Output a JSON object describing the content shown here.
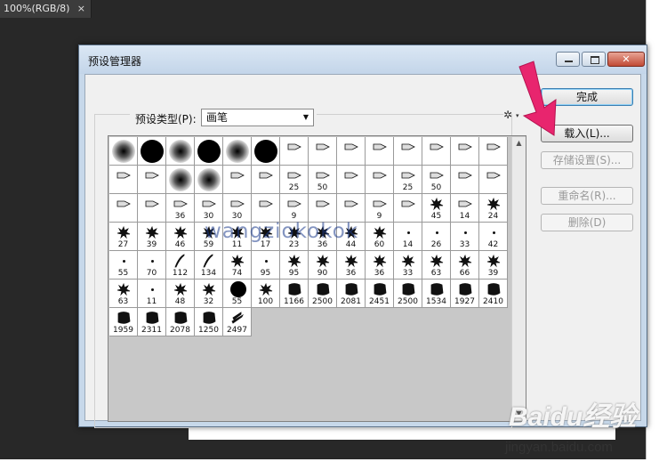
{
  "app": {
    "doc_tab_title": "100%(RGB/8)",
    "doc_tab_close": "×"
  },
  "dialog": {
    "title": "预设管理器",
    "preset_type_label": "预设类型(P):",
    "preset_type_value": "画笔",
    "gear_icon": "gear-icon",
    "buttons": {
      "done": "完成",
      "load": "载入(L)...",
      "save_set": "存储设置(S)...",
      "rename": "重命名(R)...",
      "delete": "删除(D)"
    },
    "brush_rows": [
      [
        {
          "k": "soft"
        },
        {
          "k": "hard"
        },
        {
          "k": "soft"
        },
        {
          "k": "hard"
        },
        {
          "k": "soft"
        },
        {
          "k": "hard"
        },
        {
          "k": "tip",
          "n": ""
        },
        {
          "k": "tip",
          "n": ""
        },
        {
          "k": "tip",
          "n": ""
        },
        {
          "k": "tip",
          "n": ""
        },
        {
          "k": "tip",
          "n": ""
        },
        {
          "k": "tip",
          "n": ""
        },
        {
          "k": "tip",
          "n": ""
        },
        {
          "k": "tip",
          "n": ""
        }
      ],
      [
        {
          "k": "tip",
          "n": ""
        },
        {
          "k": "tip",
          "n": ""
        },
        {
          "k": "soft"
        },
        {
          "k": "soft"
        },
        {
          "k": "tip",
          "n": ""
        },
        {
          "k": "tip",
          "n": ""
        },
        {
          "k": "tip",
          "n": "25"
        },
        {
          "k": "tip",
          "n": "50"
        },
        {
          "k": "tip",
          "n": ""
        },
        {
          "k": "tip",
          "n": ""
        },
        {
          "k": "tip",
          "n": "25"
        },
        {
          "k": "tip",
          "n": "50"
        },
        {
          "k": "tip",
          "n": ""
        },
        {
          "k": "tip",
          "n": ""
        }
      ],
      [
        {
          "k": "tip",
          "n": ""
        },
        {
          "k": "tip",
          "n": ""
        },
        {
          "k": "tip",
          "n": "36"
        },
        {
          "k": "tip",
          "n": "30"
        },
        {
          "k": "tip",
          "n": "30"
        },
        {
          "k": "tip",
          "n": ""
        },
        {
          "k": "tip",
          "n": "9"
        },
        {
          "k": "tip",
          "n": ""
        },
        {
          "k": "tip",
          "n": ""
        },
        {
          "k": "tip",
          "n": "9"
        },
        {
          "k": "tip",
          "n": ""
        },
        {
          "k": "splat",
          "n": "45"
        },
        {
          "k": "tip",
          "n": "14"
        },
        {
          "k": "splat",
          "n": "24"
        }
      ],
      [
        {
          "k": "splat",
          "n": "27"
        },
        {
          "k": "splat",
          "n": "39"
        },
        {
          "k": "splat",
          "n": "46"
        },
        {
          "k": "splat",
          "n": "59"
        },
        {
          "k": "splat",
          "n": "11"
        },
        {
          "k": "splat",
          "n": "17"
        },
        {
          "k": "splat",
          "n": "23"
        },
        {
          "k": "splat",
          "n": "36"
        },
        {
          "k": "splat",
          "n": "44"
        },
        {
          "k": "splat",
          "n": "60"
        },
        {
          "k": "dot",
          "n": "14"
        },
        {
          "k": "dot",
          "n": "26"
        },
        {
          "k": "dot",
          "n": "33"
        },
        {
          "k": "dot",
          "n": "42"
        }
      ],
      [
        {
          "k": "dot",
          "n": "55"
        },
        {
          "k": "dot",
          "n": "70"
        },
        {
          "k": "grass",
          "n": "112"
        },
        {
          "k": "grass",
          "n": "134"
        },
        {
          "k": "splat",
          "n": "74"
        },
        {
          "k": "dot",
          "n": "95"
        },
        {
          "k": "splat",
          "n": "95"
        },
        {
          "k": "splat",
          "n": "90"
        },
        {
          "k": "splat",
          "n": "36"
        },
        {
          "k": "splat",
          "n": "36"
        },
        {
          "k": "splat",
          "n": "33"
        },
        {
          "k": "splat",
          "n": "63"
        },
        {
          "k": "splat",
          "n": "66"
        },
        {
          "k": "splat",
          "n": "39"
        }
      ],
      [
        {
          "k": "splat",
          "n": "63"
        },
        {
          "k": "dot",
          "n": "11"
        },
        {
          "k": "splat",
          "n": "48"
        },
        {
          "k": "splat",
          "n": "32"
        },
        {
          "k": "smallhard",
          "n": "55"
        },
        {
          "k": "splat",
          "n": "100"
        },
        {
          "k": "blot",
          "n": "1166"
        },
        {
          "k": "blot",
          "n": "2500"
        },
        {
          "k": "blot",
          "n": "2081"
        },
        {
          "k": "blot",
          "n": "2451"
        },
        {
          "k": "blot",
          "n": "2500"
        },
        {
          "k": "blot",
          "n": "1534"
        },
        {
          "k": "blot",
          "n": "1927"
        },
        {
          "k": "blot",
          "n": "2410"
        }
      ],
      [
        {
          "k": "blot",
          "n": "1959"
        },
        {
          "k": "blot",
          "n": "2311"
        },
        {
          "k": "blot",
          "n": "2078"
        },
        {
          "k": "blot",
          "n": "1250"
        },
        {
          "k": "scribble",
          "n": "2497"
        }
      ]
    ]
  },
  "overlays": {
    "watermark": "wangziokokok",
    "baidu_logo": "Baidu经验",
    "baidu_url": "jingyan.baidu.com",
    "arrow_color": "#e8256e"
  }
}
